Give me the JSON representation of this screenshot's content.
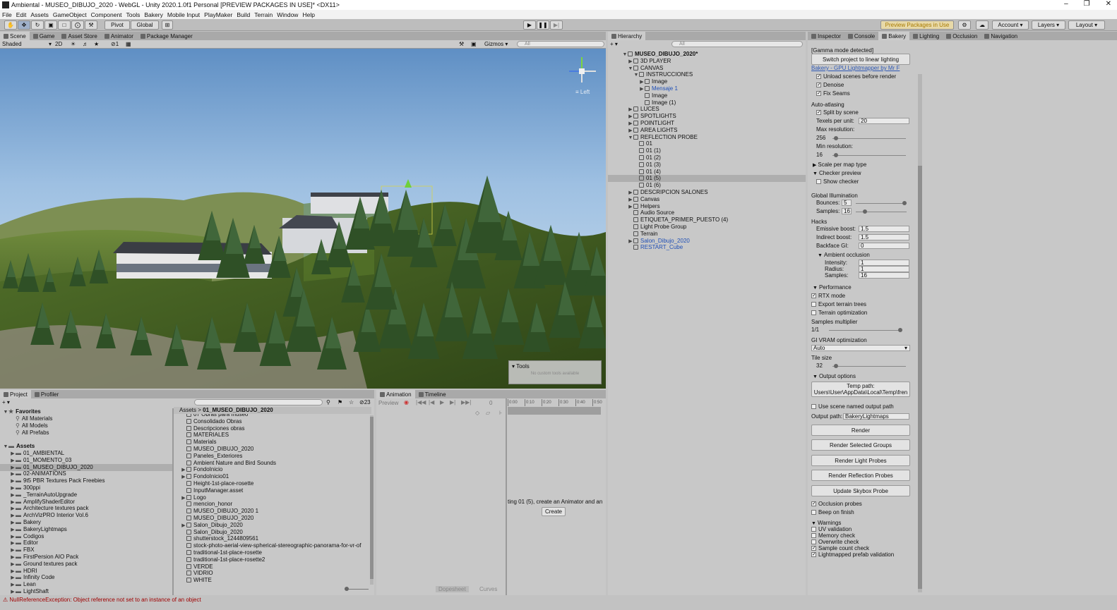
{
  "window": {
    "title": "Ambiental - MUSEO_DIBUJO_2020 - WebGL - Unity 2020.1.0f1 Personal [PREVIEW PACKAGES IN USE]* <DX11>"
  },
  "menu": [
    "File",
    "Edit",
    "Assets",
    "GameObject",
    "Component",
    "Tools",
    "Bakery",
    "Mobile Input",
    "PlayMaker",
    "Build",
    "Terrain",
    "Window",
    "Help"
  ],
  "toolbar": {
    "pivot": "Pivot",
    "global": "Global",
    "preview_packages": "Preview Packages in Use",
    "account": "Account",
    "layers": "Layers",
    "layout": "Layout"
  },
  "scene_tabs": [
    "Scene",
    "Game",
    "Asset Store",
    "Animator",
    "Package Manager"
  ],
  "scene_toolbar": {
    "shading": "Shaded",
    "mode2d": "2D",
    "layers_count": "1",
    "gizmos": "Gizmos",
    "search_placeholder": "All"
  },
  "gizmo_label": "Left",
  "tools_overlay": {
    "title": "Tools",
    "message": "No custom tools available"
  },
  "hierarchy": {
    "tab": "Hierarchy",
    "search_placeholder": "All",
    "items": [
      {
        "label": "MUSEO_DIBUJO_2020*",
        "indent": 0,
        "fold": "▼",
        "bold": true
      },
      {
        "label": "3D PLAYER",
        "indent": 1,
        "fold": "▶"
      },
      {
        "label": "CANVAS",
        "indent": 1,
        "fold": "▼"
      },
      {
        "label": "INSTRUCCIONES",
        "indent": 2,
        "fold": "▼"
      },
      {
        "label": "Image",
        "indent": 3,
        "fold": "▶"
      },
      {
        "label": "Mensaje 1",
        "indent": 3,
        "fold": "▶",
        "blue": true
      },
      {
        "label": "Image",
        "indent": 3,
        "fold": ""
      },
      {
        "label": "Image (1)",
        "indent": 3,
        "fold": ""
      },
      {
        "label": "LUCES",
        "indent": 1,
        "fold": "▶"
      },
      {
        "label": "SPOTLIGHTS",
        "indent": 1,
        "fold": "▶"
      },
      {
        "label": "POINTLIGHT",
        "indent": 1,
        "fold": "▶"
      },
      {
        "label": "AREA LIGHTS",
        "indent": 1,
        "fold": "▶"
      },
      {
        "label": "REFLECTION PROBE",
        "indent": 1,
        "fold": "▼"
      },
      {
        "label": "01",
        "indent": 2,
        "fold": ""
      },
      {
        "label": "01 (1)",
        "indent": 2,
        "fold": ""
      },
      {
        "label": "01 (2)",
        "indent": 2,
        "fold": ""
      },
      {
        "label": "01 (3)",
        "indent": 2,
        "fold": ""
      },
      {
        "label": "01 (4)",
        "indent": 2,
        "fold": ""
      },
      {
        "label": "01 (5)",
        "indent": 2,
        "fold": "",
        "selected": true
      },
      {
        "label": "01 (6)",
        "indent": 2,
        "fold": ""
      },
      {
        "label": "DESCRIPCION SALONES",
        "indent": 1,
        "fold": "▶"
      },
      {
        "label": "Canvas",
        "indent": 1,
        "fold": "▶"
      },
      {
        "label": "Helpers",
        "indent": 1,
        "fold": "▶"
      },
      {
        "label": "Audio Source",
        "indent": 1,
        "fold": ""
      },
      {
        "label": "ETIQUETA_PRIMER_PUESTO  (4)",
        "indent": 1,
        "fold": ""
      },
      {
        "label": "Light Probe Group",
        "indent": 1,
        "fold": ""
      },
      {
        "label": "Terrain",
        "indent": 1,
        "fold": ""
      },
      {
        "label": "Salon_Dibujo_2020",
        "indent": 1,
        "fold": "▶",
        "blue": true
      },
      {
        "label": "RESTART_Cube",
        "indent": 1,
        "fold": "",
        "blue": true
      }
    ]
  },
  "inspector_tabs": [
    "Inspector",
    "Console",
    "Bakery",
    "Lighting",
    "Occlusion",
    "Navigation"
  ],
  "bakery": {
    "gamma_notice": "[Gamma mode detected]",
    "switch_btn": "Switch project to linear lighting",
    "link": "Bakery - GPU Lightmapper by Mr F",
    "unload": "Unload scenes before render",
    "denoise": "Denoise",
    "fix_seams": "Fix Seams",
    "auto_atlasing": "Auto-atlasing",
    "split_by_scene": "Split by scene",
    "texels_label": "Texels per unit:",
    "texels_value": "20",
    "max_res_label": "Max resolution:",
    "max_res_value": "256",
    "max_res_frac": 0.02,
    "min_res_label": "Min resolution:",
    "min_res_value": "16",
    "min_res_frac": 0.02,
    "scale_per_map": "Scale per map type",
    "checker_preview": "Checker preview",
    "show_checker": "Show checker",
    "gi": "Global Illumination",
    "bounces_label": "Bounces:",
    "bounces_value": "5",
    "bounces_frac": 1.0,
    "samples_label": "Samples:",
    "samples_value": "16",
    "samples_frac": 0.15,
    "hacks": "Hacks",
    "emissive_label": "Emissive boost:",
    "emissive_value": "1.5",
    "indirect_label": "Indirect boost:",
    "indirect_value": "1.5",
    "backface_label": "Backface GI:",
    "backface_value": "0",
    "ao": "Ambient occlusion",
    "ao_intensity_label": "Intensity:",
    "ao_intensity_value": "1",
    "ao_radius_label": "Radius:",
    "ao_radius_value": "1",
    "ao_samples_label": "Samples:",
    "ao_samples_value": "16",
    "performance": "Performance",
    "rtx": "RTX mode",
    "export_trees": "Export terrain trees",
    "terrain_opt": "Terrain optimization",
    "samples_mult": "Samples multiplier",
    "samples_mult_value": "1/1",
    "samples_mult_frac": 1.0,
    "vram": "GI VRAM optimization",
    "vram_value": "Auto",
    "tile": "Tile size",
    "tile_value": "32",
    "tile_frac": 0.02,
    "output_options": "Output options",
    "temp_path_label": "Temp path:",
    "temp_path_value": "Users\\User\\AppData\\Local\\Temp\\fren",
    "scene_named": "Use scene named output path",
    "output_path_label": "Output path:",
    "output_path_value": "BakeryLightmaps",
    "render": "Render",
    "render_groups": "Render Selected Groups",
    "render_probes": "Render Light Probes",
    "render_reflection": "Render Reflection Probes",
    "update_skybox": "Update Skybox Probe",
    "occlusion_probes": "Occlusion probes",
    "beep": "Beep on finish",
    "warnings": "Warnings",
    "uv_validation": "UV validation",
    "memory_check": "Memory check",
    "overwrite_check": "Overwrite check",
    "sample_count": "Sample count check",
    "prefab_validation": "Lightmapped prefab validation"
  },
  "project": {
    "tabs": [
      "Project",
      "Profiler"
    ],
    "favorites": "Favorites",
    "fav_items": [
      "All Materials",
      "All Models",
      "All Prefabs"
    ],
    "assets": "Assets",
    "folders": [
      "01_AMBIENTAL",
      "01_MOMENTO_03",
      "01_MUSEO_DIBUJO_2020",
      "02-ANIMATIONS",
      "9t5 PBR Textures Pack Freebies",
      "300ppi",
      "_TerrainAutoUpgrade",
      "AmplifyShaderEditor",
      "Architecture textures pack",
      "ArchVizPRO Interior Vol.6",
      "Bakery",
      "BakeryLightmaps",
      "Codigos",
      "Editor",
      "FBX",
      "FirstPersion AIO Pack",
      "Ground textures pack",
      "HDRI",
      "Infinity Code",
      "Lean",
      "LightShaft"
    ],
    "breadcrumb": [
      "Assets",
      "01_MUSEO_DIBUJO_2020"
    ],
    "count": "23",
    "files": [
      "07 Obras para museo",
      "Consolidado Obras",
      "Descripciones obras",
      "MATERIALES",
      "Materials",
      "MUSEO_DIBUJO_2020",
      "Paneles_Exteriores",
      "Ambient Nature and Bird Sounds",
      "FondoInicio",
      "FondoInicio01",
      "Height-1st-place-rosette",
      "InputManager.asset",
      "Logo",
      "mencion_honor",
      "MUSEO_DIBUJO_2020 1",
      "MUSEO_DIBUJO_2020",
      "Salon_Dibujo_2020",
      "Salon_Dibujo_2020",
      "shutterstock_1244809561",
      "stock-photo-aerial-view-spherical-stereographic-panorama-for-vr-of",
      "traditional-1st-place-rosette",
      "traditional-1st-place-rosette2",
      "VERDE",
      "VIDRIO",
      "WHITE"
    ]
  },
  "animation": {
    "tabs": [
      "Animation",
      "Timeline"
    ],
    "preview": "Preview",
    "frame": "0",
    "ticks": [
      "0:00",
      "0:10",
      "0:20",
      "0:30",
      "0:40",
      "0:50"
    ],
    "message": "ting 01 (5), create an Animator and an",
    "create": "Create",
    "bottom_tabs": [
      "Dopesheet",
      "Curves"
    ]
  },
  "status": {
    "error": "NullReferenceException: Object reference not set to an instance of an object"
  }
}
